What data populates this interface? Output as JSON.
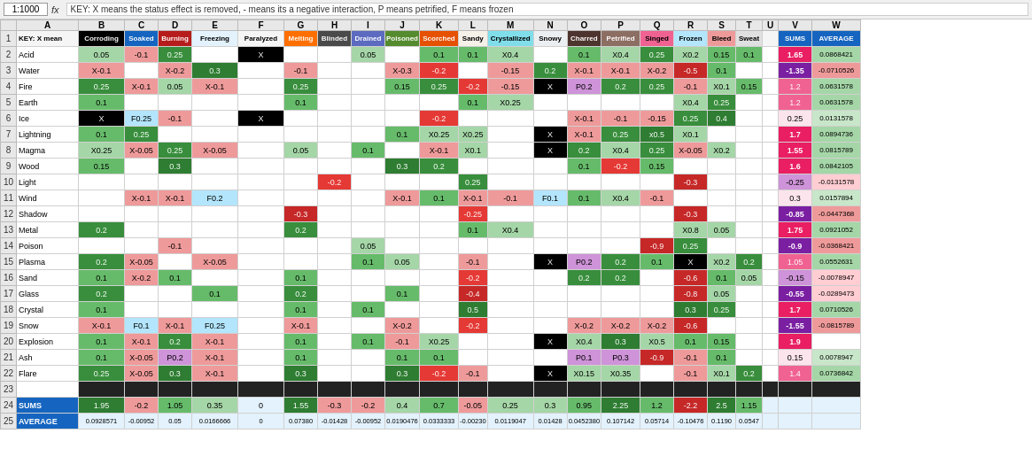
{
  "topBar": {
    "zoom": "1:1000",
    "fxLabel": "fx",
    "formula": "KEY: X means the status effect is removed, - means its a negative interaction, P means petrified, F means frozen"
  },
  "colHeaders": [
    "",
    "A",
    "B",
    "C",
    "D",
    "E",
    "F",
    "G",
    "H",
    "I",
    "J",
    "K",
    "L",
    "M",
    "N",
    "O",
    "P",
    "Q",
    "R",
    "S",
    "T",
    "U",
    "V",
    "W"
  ],
  "row1Headers": [
    "KEY: X mean",
    "Corroding",
    "Soaked",
    "Burning",
    "Freezing",
    "Paralyzed",
    "Melting",
    "Blinded",
    "Drained",
    "Poisoned",
    "Scorched",
    "Sandy",
    "Crystallized",
    "Snowy",
    "Charred",
    "Petrified",
    "Singed",
    "Frozen",
    "Bleed",
    "Sweat",
    "",
    "SUMS",
    "AVERAGE"
  ],
  "rows": [
    {
      "num": "2",
      "label": "Acid",
      "b": "0.05",
      "c": "-0.1",
      "d": "0.25",
      "e": "",
      "f": "X",
      "g": "",
      "h": "",
      "i": "0.05",
      "j": "",
      "k": "0.1",
      "l": "0.1",
      "m": "X0.4",
      "n": "",
      "o": "0.1",
      "p": "X0.4",
      "q": "0.25",
      "r": "X0.2",
      "s": "0.15",
      "t": "0.1",
      "u": "",
      "v": "1.65",
      "w": "0.0868421"
    },
    {
      "num": "3",
      "label": "Water",
      "b": "X-0.1",
      "c": "",
      "d": "X-0.2",
      "e": "0.3",
      "f": "",
      "g": "-0.1",
      "h": "",
      "i": "",
      "j": "X-0.3",
      "k": "-0.2",
      "l": "",
      "m": "-0.15",
      "n": "0.2",
      "o": "X-0.1",
      "p": "X-0.1",
      "q": "X-0.2",
      "r": "-0.5",
      "s": "0.1",
      "t": "",
      "u": "",
      "v": "-1.35",
      "w": "-0.0710526"
    },
    {
      "num": "4",
      "label": "Fire",
      "b": "0.25",
      "c": "X-0.1",
      "d": "0.05",
      "e": "X-0.1",
      "f": "",
      "g": "0.25",
      "h": "",
      "i": "",
      "j": "0.15",
      "k": "0.25",
      "l": "-0.2",
      "m": "-0.15",
      "n": "X",
      "o": "P0.2",
      "p": "0.2",
      "q": "0.25",
      "r": "-0.1",
      "s": "X0.1",
      "t": "0.15",
      "u": "",
      "v": "1.2",
      "w": "0.0631578"
    },
    {
      "num": "5",
      "label": "Earth",
      "b": "0.1",
      "c": "",
      "d": "",
      "e": "",
      "f": "",
      "g": "0.1",
      "h": "",
      "i": "",
      "j": "",
      "k": "",
      "l": "0.1",
      "m": "X0.25",
      "n": "",
      "o": "",
      "p": "",
      "q": "",
      "r": "X0.4",
      "s": "0.25",
      "t": "",
      "u": "",
      "v": "1.2",
      "w": "0.0631578"
    },
    {
      "num": "6",
      "label": "Ice",
      "b": "X",
      "c": "F0.25",
      "d": "-0.1",
      "e": "",
      "f": "X",
      "g": "",
      "h": "",
      "i": "",
      "j": "",
      "k": "-0.2",
      "l": "",
      "m": "",
      "n": "",
      "o": "X-0.1",
      "p": "-0.1",
      "q": "-0.15",
      "r": "0.25",
      "s": "0.4",
      "t": "",
      "u": "",
      "v": "0.25",
      "w": "0.0131578"
    },
    {
      "num": "7",
      "label": "Lightning",
      "b": "0.1",
      "c": "0.25",
      "d": "",
      "e": "",
      "f": "",
      "g": "",
      "h": "",
      "i": "",
      "j": "0.1",
      "k": "X0.25",
      "l": "X0.25",
      "m": "",
      "n": "X",
      "o": "X-0.1",
      "p": "0.25",
      "q": "x0.5",
      "r": "X0.1",
      "s": "",
      "t": "",
      "u": "",
      "v": "1.7",
      "w": "0.0894736"
    },
    {
      "num": "8",
      "label": "Magma",
      "b": "X0.25",
      "c": "X-0.05",
      "d": "0.25",
      "e": "X-0.05",
      "f": "",
      "g": "0.05",
      "h": "",
      "i": "0.1",
      "j": "",
      "k": "X-0.1",
      "l": "X0.1",
      "m": "",
      "n": "X",
      "o": "0.2",
      "p": "X0.4",
      "q": "0.25",
      "r": "X-0.05",
      "s": "X0.2",
      "t": "",
      "u": "",
      "v": "1.55",
      "w": "0.0815789"
    },
    {
      "num": "9",
      "label": "Wood",
      "b": "0.15",
      "c": "",
      "d": "0.3",
      "e": "",
      "f": "",
      "g": "",
      "h": "",
      "i": "",
      "j": "0.3",
      "k": "0.2",
      "l": "",
      "m": "",
      "n": "",
      "o": "0.1",
      "p": "-0.2",
      "q": "0.15",
      "r": "",
      "s": "",
      "t": "",
      "u": "",
      "v": "1.6",
      "w": "0.0842105"
    },
    {
      "num": "10",
      "label": "Light",
      "b": "",
      "c": "",
      "d": "",
      "e": "",
      "f": "",
      "g": "",
      "h": "-0.2",
      "i": "",
      "j": "",
      "k": "",
      "l": "0.25",
      "m": "",
      "n": "",
      "o": "",
      "p": "",
      "q": "",
      "r": "-0.3",
      "s": "",
      "t": "",
      "u": "",
      "v": "-0.25",
      "w": "-0.0131578"
    },
    {
      "num": "11",
      "label": "Wind",
      "b": "",
      "c": "X-0.1",
      "d": "X-0.1",
      "e": "F0.2",
      "f": "",
      "g": "",
      "h": "",
      "i": "",
      "j": "X-0.1",
      "k": "0.1",
      "l": "X-0.1",
      "m": "-0.1",
      "n": "F0.1",
      "o": "0.1",
      "p": "X0.4",
      "q": "-0.1",
      "r": "",
      "s": "",
      "t": "",
      "u": "",
      "v": "0.3",
      "w": "0.0157894"
    },
    {
      "num": "12",
      "label": "Shadow",
      "b": "",
      "c": "",
      "d": "",
      "e": "",
      "f": "",
      "g": "-0.3",
      "h": "",
      "i": "",
      "j": "",
      "k": "",
      "l": "-0.25",
      "m": "",
      "n": "",
      "o": "",
      "p": "",
      "q": "",
      "r": "-0.3",
      "s": "",
      "t": "",
      "u": "",
      "v": "-0.85",
      "w": "-0.0447368"
    },
    {
      "num": "13",
      "label": "Metal",
      "b": "0.2",
      "c": "",
      "d": "",
      "e": "",
      "f": "",
      "g": "0.2",
      "h": "",
      "i": "",
      "j": "",
      "k": "",
      "l": "0.1",
      "m": "X0.4",
      "n": "",
      "o": "",
      "p": "",
      "q": "",
      "r": "X0.8",
      "s": "0.05",
      "t": "",
      "u": "",
      "v": "1.75",
      "w": "0.0921052"
    },
    {
      "num": "14",
      "label": "Poison",
      "b": "",
      "c": "",
      "d": "-0.1",
      "e": "",
      "f": "",
      "g": "",
      "h": "",
      "i": "0.05",
      "j": "",
      "k": "",
      "l": "",
      "m": "",
      "n": "",
      "o": "",
      "p": "",
      "q": "-0.9",
      "r": "0.25",
      "s": "",
      "t": "",
      "u": "",
      "v": "-0.9",
      "w": "-0.0368421"
    },
    {
      "num": "15",
      "label": "Plasma",
      "b": "0.2",
      "c": "X-0.05",
      "d": "",
      "e": "X-0.05",
      "f": "",
      "g": "",
      "h": "",
      "i": "0.1",
      "j": "0.05",
      "k": "",
      "l": "-0.1",
      "m": "",
      "n": "X",
      "o": "P0.2",
      "p": "0.2",
      "q": "0.1",
      "r": "X",
      "s": "X0.2",
      "t": "0.2",
      "u": "",
      "v": "1.05",
      "w": "0.0552631"
    },
    {
      "num": "16",
      "label": "Sand",
      "b": "0.1",
      "c": "X-0.2",
      "d": "0.1",
      "e": "",
      "f": "",
      "g": "0.1",
      "h": "",
      "i": "",
      "j": "",
      "k": "",
      "l": "-0.2",
      "m": "",
      "n": "",
      "o": "0.2",
      "p": "0.2",
      "q": "",
      "r": "-0.6",
      "s": "0.1",
      "t": "0.05",
      "u": "",
      "v": "-0.15",
      "w": "-0.0078947"
    },
    {
      "num": "17",
      "label": "Glass",
      "b": "0.2",
      "c": "",
      "d": "",
      "e": "0.1",
      "f": "",
      "g": "0.2",
      "h": "",
      "i": "",
      "j": "0.1",
      "k": "",
      "l": "-0.4",
      "m": "",
      "n": "",
      "o": "",
      "p": "",
      "q": "",
      "r": "-0.8",
      "s": "0.05",
      "t": "",
      "u": "",
      "v": "-0.55",
      "w": "-0.0289473"
    },
    {
      "num": "18",
      "label": "Crystal",
      "b": "0.1",
      "c": "",
      "d": "",
      "e": "",
      "f": "",
      "g": "0.1",
      "h": "",
      "i": "0.1",
      "j": "",
      "k": "",
      "l": "0.5",
      "m": "",
      "n": "",
      "o": "",
      "p": "",
      "q": "",
      "r": "0.3",
      "s": "0.25",
      "t": "",
      "u": "",
      "v": "1.7",
      "w": "0.0710526"
    },
    {
      "num": "19",
      "label": "Snow",
      "b": "X-0.1",
      "c": "F0.1",
      "d": "X-0.1",
      "e": "F0.25",
      "f": "",
      "g": "X-0.1",
      "h": "",
      "i": "",
      "j": "X-0.2",
      "k": "",
      "l": "-0.2",
      "m": "",
      "n": "",
      "o": "X-0.2",
      "p": "X-0.2",
      "q": "X-0.2",
      "r": "-0.6",
      "s": "",
      "t": "",
      "u": "",
      "v": "-1.55",
      "w": "-0.0815789"
    },
    {
      "num": "20",
      "label": "Explosion",
      "b": "0.1",
      "c": "X-0.1",
      "d": "0.2",
      "e": "X-0.1",
      "f": "",
      "g": "0.1",
      "h": "",
      "i": "0.1",
      "j": "-0.1",
      "k": "X0.25",
      "l": "",
      "m": "",
      "n": "X",
      "o": "X0.4",
      "p": "0.3",
      "q": "X0.5",
      "r": "0.1",
      "s": "0.15",
      "t": "",
      "u": "",
      "v": "1.9",
      "w": ""
    },
    {
      "num": "21",
      "label": "Ash",
      "b": "0.1",
      "c": "X-0.05",
      "d": "P0.2",
      "e": "X-0.1",
      "f": "",
      "g": "0.1",
      "h": "",
      "i": "",
      "j": "0.1",
      "k": "0.1",
      "l": "",
      "m": "",
      "n": "",
      "o": "P0.1",
      "p": "P0.3",
      "q": "-0.9",
      "r": "-0.1",
      "s": "0.1",
      "t": "",
      "u": "",
      "v": "0.15",
      "w": "0.0078947"
    },
    {
      "num": "22",
      "label": "Flare",
      "b": "0.25",
      "c": "X-0.05",
      "d": "0.3",
      "e": "X-0.1",
      "f": "",
      "g": "0.3",
      "h": "",
      "i": "",
      "j": "0.3",
      "k": "-0.2",
      "l": "-0.1",
      "m": "",
      "n": "X",
      "o": "X0.15",
      "p": "X0.35",
      "q": "",
      "r": "-0.1",
      "s": "X0.1",
      "t": "0.2",
      "u": "",
      "v": "1.4",
      "w": "0.0736842"
    },
    {
      "num": "23",
      "label": "",
      "b": "",
      "c": "",
      "d": "",
      "e": "",
      "f": "",
      "g": "",
      "h": "",
      "i": "",
      "j": "",
      "k": "",
      "l": "",
      "m": "",
      "n": "",
      "o": "",
      "p": "",
      "q": "",
      "r": "",
      "s": "",
      "t": "",
      "u": "",
      "v": "",
      "w": ""
    },
    {
      "num": "24",
      "label": "SUMS",
      "b": "1.95",
      "c": "-0.2",
      "d": "1.05",
      "e": "0.35",
      "f": "0",
      "g": "1.55",
      "h": "-0.3",
      "i": "-0.2",
      "j": "0.4",
      "k": "0.7",
      "l": "-0.05",
      "m": "0.25",
      "n": "0.3",
      "o": "0.95",
      "p": "2.25",
      "q": "1.2",
      "r": "-2.2",
      "s": "2.5",
      "t": "1.15",
      "u": "",
      "v": "",
      "w": ""
    },
    {
      "num": "25",
      "label": "AVERAGE",
      "b": "0.0928571",
      "c": "-0.00952",
      "d": "0.05",
      "e": "0.0166666",
      "f": "0",
      "g": "0.07380",
      "h": "-0.01428",
      "i": "-0.00952",
      "j": "0.0190476",
      "k": "0.0333333",
      "l": "-0.00230",
      "m": "0.0119047",
      "n": "0.01428",
      "o": "0.0452380",
      "p": "0.107142",
      "q": "0.05714",
      "r": "-0.10476",
      "s": "0.1190",
      "t": "0.0547",
      "u": "",
      "v": "",
      "w": ""
    }
  ]
}
